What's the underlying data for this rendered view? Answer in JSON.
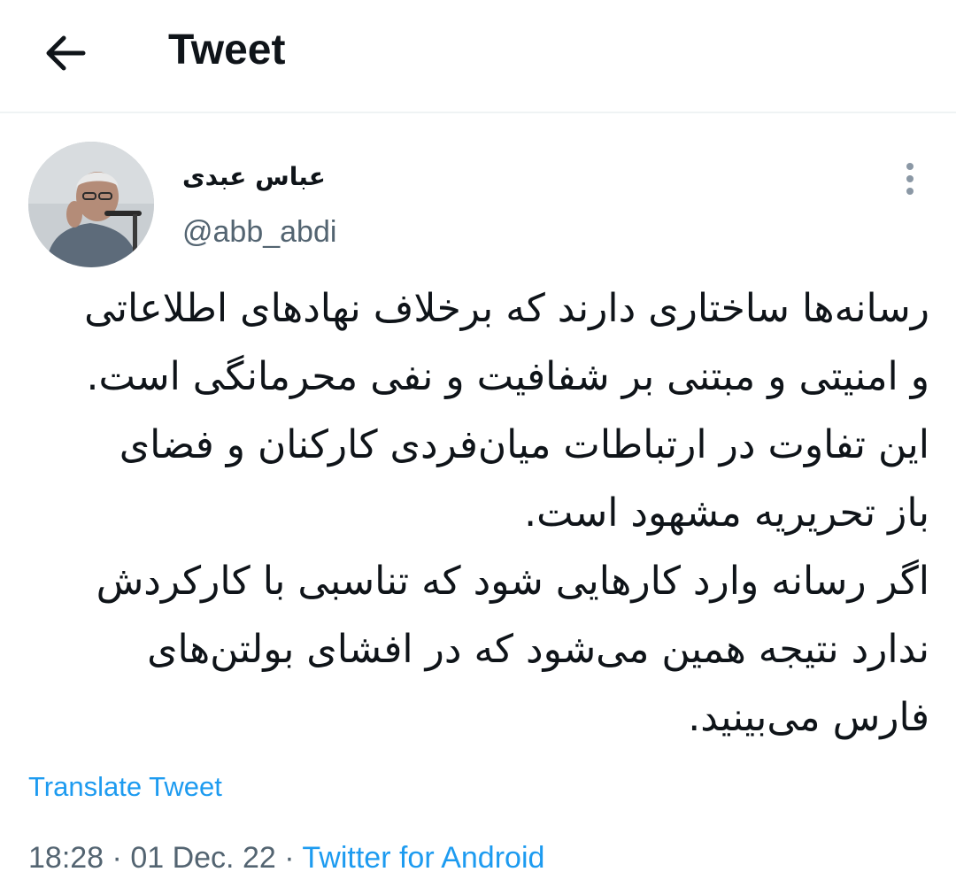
{
  "header": {
    "back_icon": "arrow-left-icon",
    "title": "Tweet"
  },
  "author": {
    "avatar_icon": "profile-photo",
    "name": "عباس عبدی",
    "handle": "@abb_abdi"
  },
  "more_icon": "more-vertical-icon",
  "tweet": {
    "lines": [
      "رسانه‌ها ساختاری دارند که برخلاف نهادهای اطلاعاتی",
      "و امنیتی و مبتنی بر شفافیت و نفی محرمانگی است.",
      "این تفاوت در ارتباطات میان‌فردی کارکنان و فضای",
      "باز تحریریه مشهود است.",
      "اگر رسانه وارد کارهایی شود که تناسبی با کارکردش",
      "ندارد نتیجه همین می‌شود که در افشای بولتن‌های",
      "فارس می‌بینید."
    ]
  },
  "translate_label": "Translate Tweet",
  "meta": {
    "time": "18:28",
    "separator": "·",
    "date": "01 Dec. 22",
    "source": "Twitter for Android"
  },
  "colors": {
    "link": "#1d9bf0",
    "secondary_text": "#536471",
    "primary_text": "#0f1419",
    "divider": "#eff3f4"
  }
}
